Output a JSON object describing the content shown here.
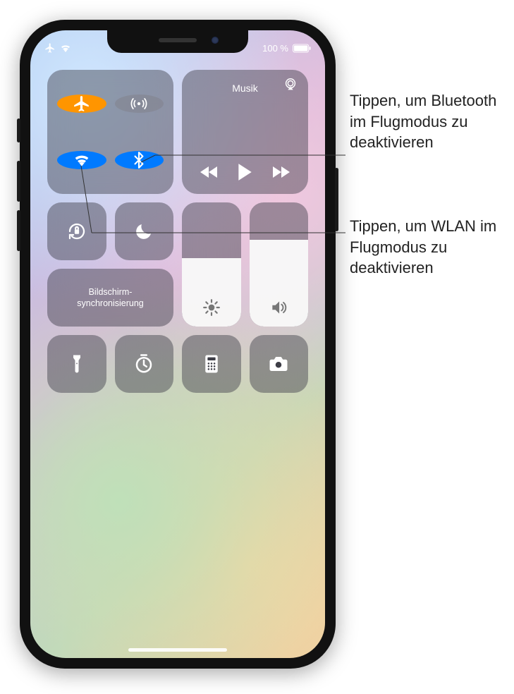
{
  "statusbar": {
    "battery_pct": "100 %"
  },
  "connectivity": {
    "airplane_on": true,
    "cellular_on": false,
    "wifi_on": true,
    "bluetooth_on": true
  },
  "music": {
    "title": "Musik"
  },
  "tiles": {
    "screen_mirroring": "Bildschirm-\nsynchronisierung"
  },
  "sliders": {
    "brightness_pct": 55,
    "volume_pct": 70
  },
  "callouts": {
    "bluetooth": "Tippen, um Bluetooth im Flugmodus zu deaktivieren",
    "wlan": "Tippen, um WLAN im Flugmodus zu deaktivieren"
  },
  "colors": {
    "active_orange": "#ff9500",
    "active_blue": "#007aff"
  }
}
